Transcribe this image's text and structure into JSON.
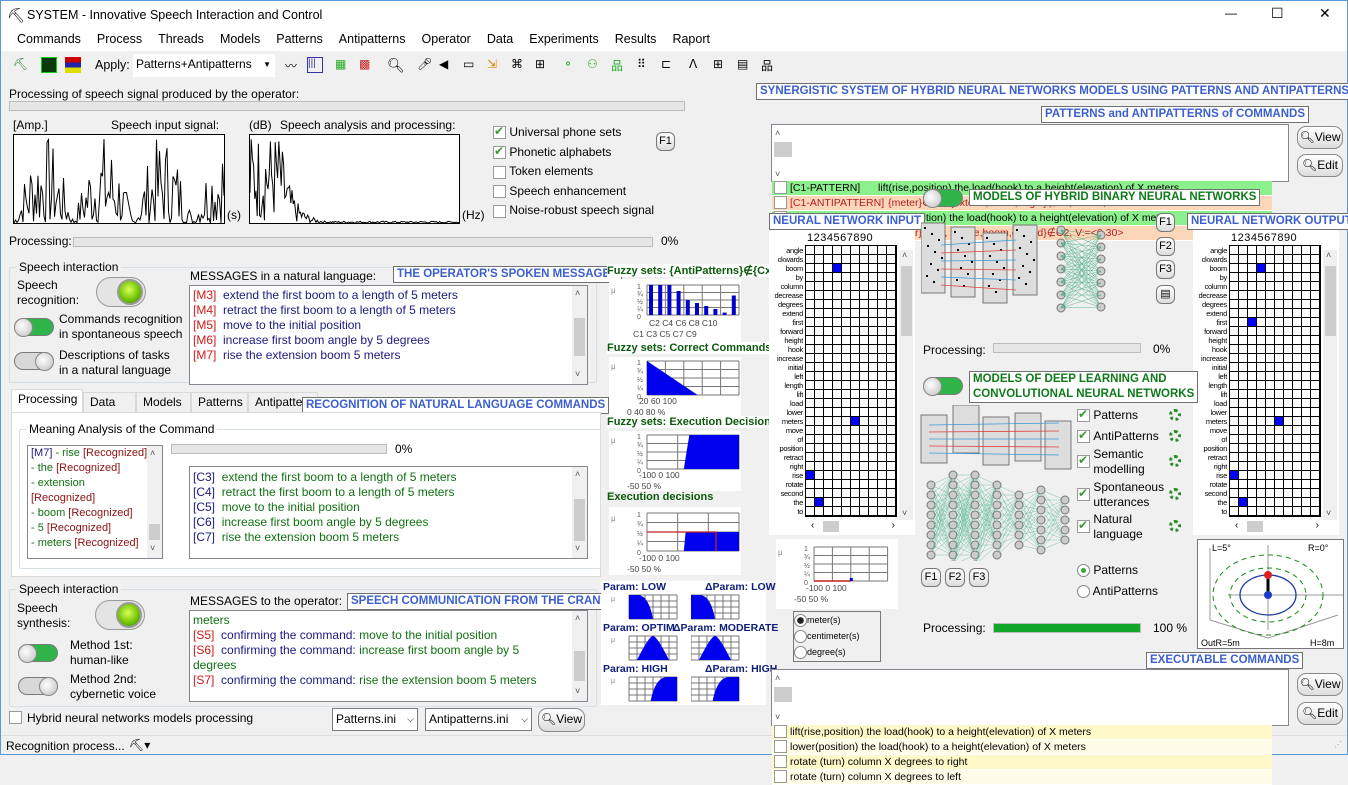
{
  "window": {
    "title": "SYSTEM - Innovative Speech Interaction and Control",
    "minimize": "—",
    "maximize": "☐",
    "close": "✕"
  },
  "menu": [
    "Commands",
    "Process",
    "Threads",
    "Models",
    "Patterns",
    "Antipatterns",
    "Operator",
    "Data",
    "Experiments",
    "Results",
    "Raport"
  ],
  "toolbar": {
    "apply_label": "Apply:",
    "apply_value": "Patterns+Antipatterns"
  },
  "signal": {
    "heading": "Processing of speech signal produced by the operator:",
    "amp_label": "[Amp.]",
    "input_title": "Speech input signal:",
    "s_unit": "(s)",
    "db_label": "(dB)",
    "analysis_title": "Speech analysis and processing:",
    "hz_unit": "(Hz)",
    "processing_label": "Processing:",
    "processing_pct": "0%",
    "processing_value": 0
  },
  "options": [
    {
      "label": "Universal phone sets",
      "checked": true
    },
    {
      "label": "Phonetic alphabets",
      "checked": true
    },
    {
      "label": "Token elements",
      "checked": false
    },
    {
      "label": "Speech enhancement",
      "checked": false
    },
    {
      "label": "Noise-robust speech signal",
      "checked": false
    }
  ],
  "f1": "F1",
  "f2": "F2",
  "f3": "F3",
  "recognition": {
    "group": "Speech interaction",
    "speech_recognition": "Speech\nrecognition:",
    "cmd_spont_1": "Commands recognition",
    "cmd_spont_2": "in spontaneous speech",
    "desc_1": "Descriptions of tasks",
    "desc_2": "in a natural language",
    "messages_label": "MESSAGES in a natural language:",
    "tag": "THE OPERATOR'S SPOKEN MESSAGES",
    "messages": [
      {
        "id": "[M3]",
        "text": "extend the first boom to a length of 5 meters"
      },
      {
        "id": "[M4]",
        "text": "retract the first boom to a length of 5 meters"
      },
      {
        "id": "[M5]",
        "text": "move to the initial position"
      },
      {
        "id": "[M6]",
        "text": "increase first boom angle by 5 degrees"
      },
      {
        "id": "[M7]",
        "text": "rise the extension boom 5 meters"
      }
    ]
  },
  "tabs": [
    "Processing",
    "Data",
    "Models",
    "Patterns",
    "Antipatte"
  ],
  "nlc_tag": "RECOGNITION OF NATURAL LANGUAGE COMMANDS",
  "meaning": {
    "group": "Meaning Analysis of the Command",
    "pct": "0%",
    "progress": 0,
    "words": [
      {
        "pre": "[M7]",
        "word": " - rise ",
        "status": "[Recognized]"
      },
      {
        "pre": "",
        "word": "- the ",
        "status": "[Recognized]"
      },
      {
        "pre": "",
        "word": "- extension",
        "status": ""
      },
      {
        "pre": "",
        "word": "",
        "status": "[Recognized]"
      },
      {
        "pre": "",
        "word": "- boom ",
        "status": "[Recognized]"
      },
      {
        "pre": "",
        "word": "- 5 ",
        "status": "[Recognized]"
      },
      {
        "pre": "",
        "word": "- meters ",
        "status": "[Recognized]"
      }
    ],
    "commands": [
      {
        "id": "[C3]",
        "text": "extend the first boom to a length of 5 meters"
      },
      {
        "id": "[C4]",
        "text": "retract the first boom to a length of 5 meters"
      },
      {
        "id": "[C5]",
        "text": "move to the initial position"
      },
      {
        "id": "[C6]",
        "text": "increase first boom angle by 5 degrees"
      },
      {
        "id": "[C7]",
        "text": "rise the extension boom 5 meters"
      }
    ]
  },
  "synthesis": {
    "group": "Speech interaction",
    "label1": "Speech",
    "label2": "synthesis:",
    "m1a": "Method 1st:",
    "m1b": "human-like",
    "m2a": "Method 2nd:",
    "m2b": "cybernetic voice",
    "messages_label": "MESSAGES to the operator:",
    "tag": "SPEECH COMMUNICATION FROM THE CRANE",
    "cont": "meters",
    "confirm": "confirming the command:",
    "messages": [
      {
        "id": "[S5]",
        "text": "move to the initial position",
        "wrap": ""
      },
      {
        "id": "[S6]",
        "text": "increase first boom angle by 5",
        "wrap": "degrees"
      },
      {
        "id": "[S7]",
        "text": "rise the extension boom 5 meters",
        "wrap": ""
      }
    ]
  },
  "bottom": {
    "hybrid_label": "Hybrid neural networks models processing",
    "patterns_file": "Patterns.ini",
    "antipatterns_file": "Antipatterns.ini",
    "view": "View"
  },
  "status": {
    "text": "Recognition process..."
  },
  "fuzzy": {
    "antipatterns": {
      "title": "Fuzzy sets: {AntiPatterns}∉{Cx}",
      "categories": [
        "C1",
        "C2",
        "C3",
        "C4",
        "C5",
        "C6",
        "C7",
        "C8",
        "C9",
        "C10"
      ],
      "values": [
        1,
        1,
        1,
        0.8,
        0.5,
        0.4,
        0.3,
        0.2,
        0.08,
        0.65
      ],
      "xlabels_top": "C2   C4   C6   C8  C10",
      "xlabels_bottom": "C1   C3   C5   C7   C9"
    },
    "correct": {
      "title": "Fuzzy sets: Correct Commands",
      "ticks_top": "20      60      100",
      "ticks_bottom": "0      40      80 %"
    },
    "decision": {
      "title": "Fuzzy sets: Execution Decision",
      "ticks_top": "-100      0      100",
      "ticks_bottom": "-50      50  %"
    },
    "execution": {
      "title": "Execution decisions",
      "ticks_top": "-100      0      100",
      "ticks_bottom": "-50      50  %",
      "level": 0.5,
      "marker": 50
    },
    "mu": "μ",
    "ylabels": [
      "1",
      "¾",
      "½",
      "¼",
      "0"
    ],
    "params": [
      {
        "title": "Param: LOW",
        "shape": "low"
      },
      {
        "title": "ΔParam: LOW",
        "shape": "low"
      },
      {
        "title": "Param: OPTIM",
        "shape": "mid"
      },
      {
        "title": "ΔParam: MODERATE",
        "shape": "mid"
      },
      {
        "title": "Param: HIGH",
        "shape": "high"
      },
      {
        "title": "ΔParam: HIGH",
        "shape": "high"
      }
    ]
  },
  "right": {
    "title": "SYNERGISTIC SYSTEM OF HYBRID NEURAL NETWORKS MODELS USING PATTERNS AND ANTIPATTERNS",
    "patterns_tag": "PATTERNS and ANTIPATTERNS of COMMANDS",
    "patterns": [
      {
        "id": "[C1-PATTERN]",
        "text": "lift(rise,position) the load(hook) to a height(elevation) of X meters",
        "type": "pattern"
      },
      {
        "id": "[C1-ANTIPATTERN]",
        "text": "{meter}∈C1, {extend,boom,angle}∉C1, V:=<0,30>",
        "type": "anti"
      },
      {
        "id": "[C2-PATTERN]",
        "text": "lower(position) the load(hook) to a height(elevation) of X meters",
        "type": "pattern"
      },
      {
        "id": "[C2-ANTIPATTERN]",
        "text": "{meter}∈C2, {angle,boom,extend}∉C2, V:=<0,30>",
        "type": "anti"
      }
    ],
    "view": "View",
    "edit": "Edit",
    "binary_tag": "MODELS OF HYBRID BINARY NEURAL NETWORKS",
    "input_tag": "NEURAL NETWORK INPUT",
    "output_tag": "NEURAL NETWORK OUTPUT",
    "grid_header": "1234567890",
    "words": [
      "angle",
      "ckwards",
      "boom",
      "by",
      "column",
      "decrease",
      "degrees",
      "extend",
      "first",
      "forward",
      "height",
      "hook",
      "increase",
      "initial",
      "left",
      "length",
      "lift",
      "load",
      "lower",
      "meters",
      "move",
      "of",
      "position",
      "retract",
      "right",
      "rise",
      "rotate",
      "second",
      "the",
      "to"
    ],
    "input_active": {
      "boom": 4,
      "meters": 6,
      "rise": 1,
      "the": 2
    },
    "output_active": {
      "boom": 4,
      "first": 3,
      "meters": 6,
      "rise": 1,
      "the": 2
    },
    "processing_label": "Processing:",
    "processing1_pct": "0%",
    "processing1": 0,
    "deep_tag_1": "MODELS OF DEEP LEARNING AND",
    "deep_tag_2": "CONVOLUTIONAL NEURAL NETWORKS",
    "deep_options": [
      {
        "label": "Patterns",
        "checked": true
      },
      {
        "label": "AntiPatterns",
        "checked": true
      },
      {
        "label": "Semantic\nmodelling",
        "checked": true
      },
      {
        "label": "Spontaneous\nutterances",
        "checked": true
      },
      {
        "label": "Natural\nlanguage",
        "checked": true
      }
    ],
    "mode_radios": [
      {
        "label": "Patterns",
        "selected": true
      },
      {
        "label": "AntiPatterns",
        "selected": false
      }
    ],
    "processing2_pct": "100 %",
    "processing2": 100,
    "small_chart": {
      "ticks_top": "-100      0      100",
      "ticks_bottom": "-50    50 %"
    },
    "units": [
      {
        "label": "meter(s)",
        "selected": true
      },
      {
        "label": "centimeter(s)",
        "selected": false
      },
      {
        "label": "degree(s)",
        "selected": false
      }
    ],
    "crane": {
      "l": "L=5°",
      "r": "R=0°",
      "outr": "OutR=5m",
      "h": "H=8m"
    },
    "exec_tag": "EXECUTABLE COMMANDS",
    "executable": [
      "lift(rise,position) the load(hook) to a height(elevation) of X meters",
      "lower(position) the load(hook) to a height(elevation) of X meters",
      "rotate (turn) column X degrees to right",
      "rotate (turn) column X degrees to left"
    ]
  },
  "colors": {
    "accent_blue": "#3b5fd0",
    "tag_green": "#0f7a1a",
    "pattern_row": "#8cf08c",
    "antipattern_row": "#fcd6b8",
    "exec_row": "#fff8c8",
    "progress_green": "#11a82a",
    "mark_blue": "#0000ff"
  }
}
